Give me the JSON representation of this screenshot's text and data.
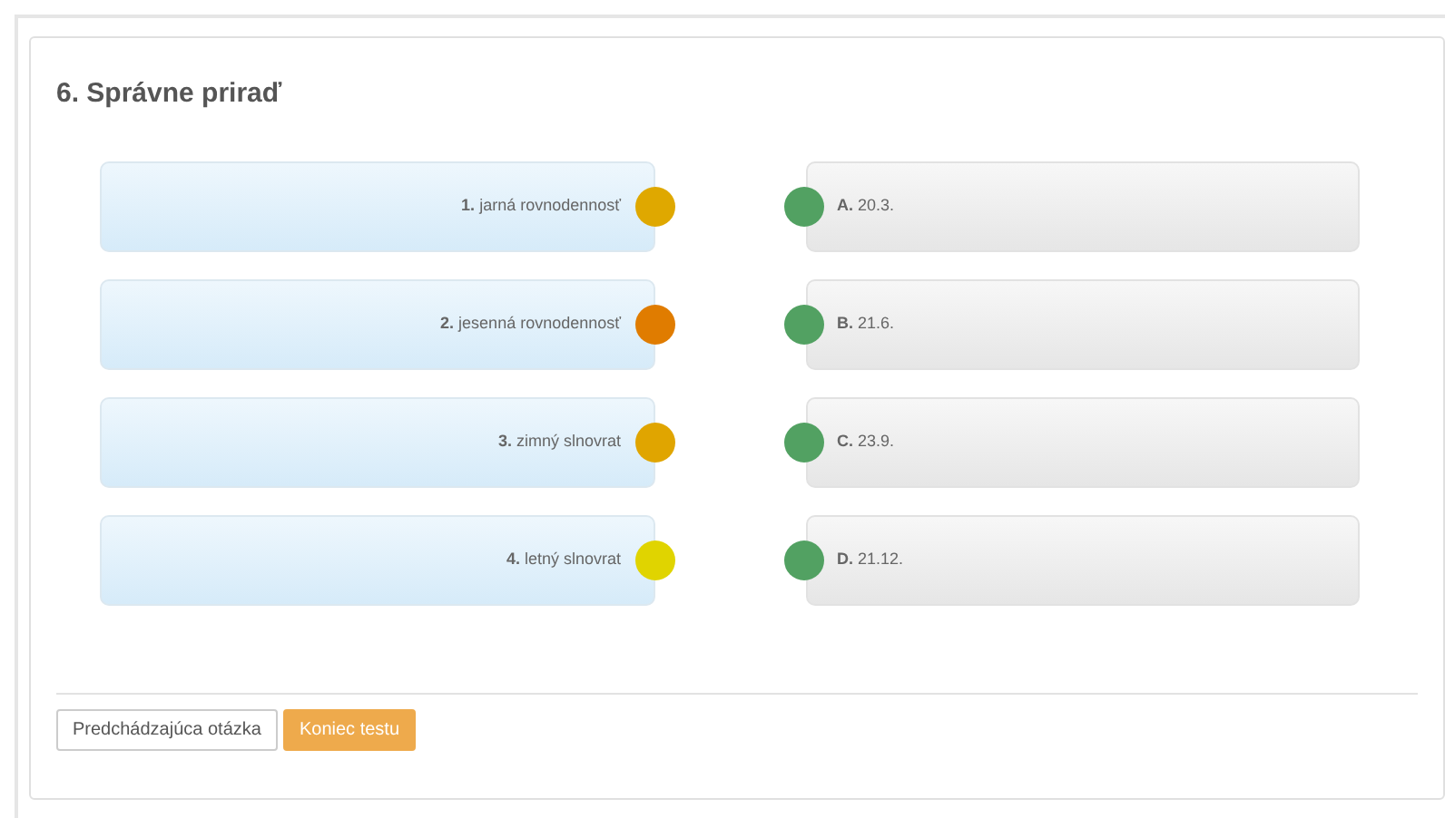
{
  "question": {
    "title": "6. Správne priraď"
  },
  "left": [
    {
      "label": "**1.** jarná rovnodennosť",
      "color": "#dfa800"
    },
    {
      "label": "**2.** jesenná rovnodennosť",
      "color": "#e07c00"
    },
    {
      "label": "**3.** zimný slnovrat",
      "color": "#e0a500"
    },
    {
      "label": "**4.** letný slnovrat",
      "color": "#e0d400"
    }
  ],
  "right": [
    {
      "label": "**A.** 20.3.",
      "color": "#52a162"
    },
    {
      "label": "**B.** 21.6.",
      "color": "#52a162"
    },
    {
      "label": "**C.** 23.9.",
      "color": "#52a162"
    },
    {
      "label": "**D.** 21.12.",
      "color": "#52a162"
    }
  ],
  "buttons": [
    {
      "label": "Predchádzajúca otázka",
      "kind": "secondary"
    },
    {
      "label": "Koniec testu",
      "kind": "primary"
    }
  ]
}
